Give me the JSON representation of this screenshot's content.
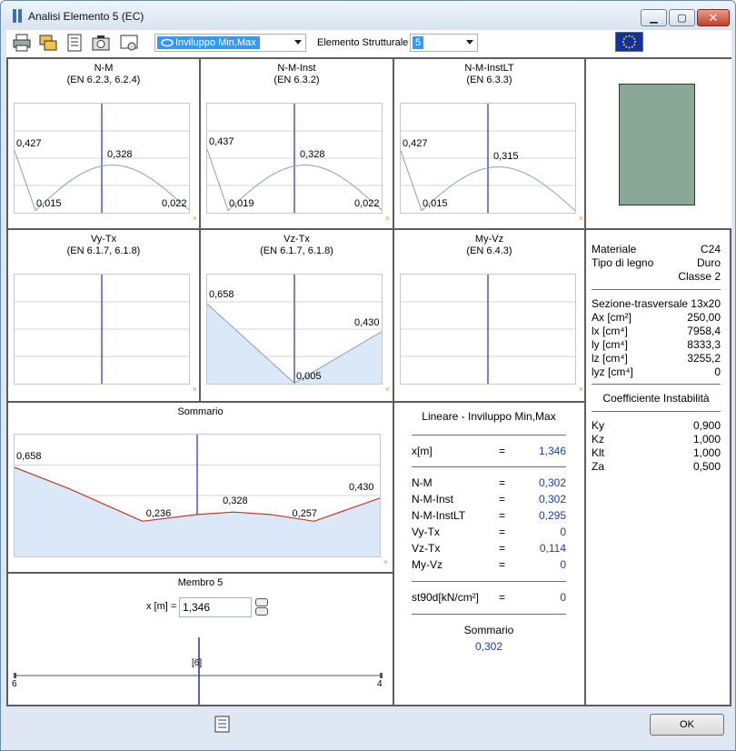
{
  "window": {
    "title": "Analisi Elemento 5 (EC)"
  },
  "toolbar": {
    "combo_value": "Inviluppo Min,Max",
    "elemento_label": "Elemento Strutturale",
    "elemento_value": "5"
  },
  "charts": [
    {
      "title": "N-M",
      "subtitle": "(EN 6.2.3, 6.2.4)",
      "labels": [
        "0,427",
        "0,015",
        "0,328",
        "0,022"
      ]
    },
    {
      "title": "N-M-Inst",
      "subtitle": "(EN 6.3.2)",
      "labels": [
        "0,437",
        "0,019",
        "0,328",
        "0,022"
      ]
    },
    {
      "title": "N-M-InstLT",
      "subtitle": "(EN 6.3.3)",
      "labels": [
        "0,427",
        "0,015",
        "0,315"
      ]
    },
    {
      "title": "Vy-Tx",
      "subtitle": "(EN 6.1.7, 6.1.8)",
      "labels": []
    },
    {
      "title": "Vz-Tx",
      "subtitle": "(EN 6.1.7, 6.1.8)",
      "labels": [
        "0,658",
        "0,005",
        "0,430"
      ]
    },
    {
      "title": "My-Vz",
      "subtitle": "(EN 6.4.3)",
      "labels": []
    },
    {
      "title": "Sommario",
      "subtitle": "",
      "labels": [
        "0,658",
        "0,236",
        "0,328",
        "0,257",
        "0,430"
      ]
    }
  ],
  "chart_data": [
    {
      "type": "line",
      "title": "N-M",
      "x": [
        0,
        0.5,
        1
      ],
      "series": [
        {
          "values": [
            0.427,
            0.328,
            0.022
          ]
        }
      ]
    },
    {
      "type": "line",
      "title": "N-M-Inst",
      "x": [
        0,
        0.5,
        1
      ],
      "series": [
        {
          "values": [
            0.437,
            0.328,
            0.022
          ]
        }
      ]
    },
    {
      "type": "line",
      "title": "N-M-InstLT",
      "x": [
        0,
        0.5,
        1
      ],
      "series": [
        {
          "values": [
            0.427,
            0.315,
            0.0
          ]
        }
      ]
    },
    {
      "type": "line",
      "title": "Vz-Tx",
      "x": [
        0,
        0.5,
        1
      ],
      "series": [
        {
          "values": [
            0.658,
            0.005,
            0.43
          ]
        }
      ]
    },
    {
      "type": "line",
      "title": "Sommario",
      "x": [
        0,
        0.5,
        1
      ],
      "series": [
        {
          "values": [
            0.658,
            0.328,
            0.43
          ]
        }
      ]
    }
  ],
  "properties": {
    "materiale_k": "Materiale",
    "materiale_v": "C24",
    "tipo_k": "Tipo di legno",
    "tipo_v": "Duro",
    "classe_v": "Classe 2",
    "sezione_k": "Sezione-trasversale",
    "sezione_v": "13x20",
    "ax_k": "Ax [cm²]",
    "ax_v": "250,00",
    "lx_k": "lx [cm⁴]",
    "lx_v": "7958,4",
    "ly_k": "ly [cm⁴]",
    "ly_v": "8333,3",
    "lz_k": "lz [cm⁴]",
    "lz_v": "3255,2",
    "lyz_k": "lyz [cm⁴]",
    "lyz_v": "0",
    "coeff_title": "Coefficiente Instabilità",
    "ky_k": "Ky",
    "ky_v": "0,900",
    "kz_k": "Kz",
    "kz_v": "1,000",
    "klt_k": "Klt",
    "klt_v": "1,000",
    "za_k": "Za",
    "za_v": "0,500"
  },
  "results": {
    "title": "Lineare - Inviluppo Min,Max",
    "eq": "=",
    "x_k": "x[m]",
    "x_v": "1,346",
    "nm_k": "N-M",
    "nm_v": "0,302",
    "nmi_k": "N-M-Inst",
    "nmi_v": "0,302",
    "nmilt_k": "N-M-InstLT",
    "nmilt_v": "0,295",
    "vy_k": "Vy-Tx",
    "vy_v": "0",
    "vz_k": "Vz-Tx",
    "vz_v": "0,114",
    "my_k": "My-Vz",
    "my_v": "0",
    "st_k": "st90d[kN/cm²]",
    "st_v": "0",
    "sommario_k": "Sommario",
    "sommario_v": "0,302"
  },
  "membro": {
    "title": "Membro 5",
    "x_label": "x [m] =",
    "x_value": "1,346",
    "node_left": "6",
    "node_right": "4",
    "node_mid": "[6]"
  },
  "buttons": {
    "ok": "OK"
  },
  "colors": {
    "axis_blue": "#1f2fa8",
    "curve": "#8a9fc2",
    "envelope": "#c0392b",
    "fill": "#dbe8f8",
    "section": "#8aa898"
  }
}
